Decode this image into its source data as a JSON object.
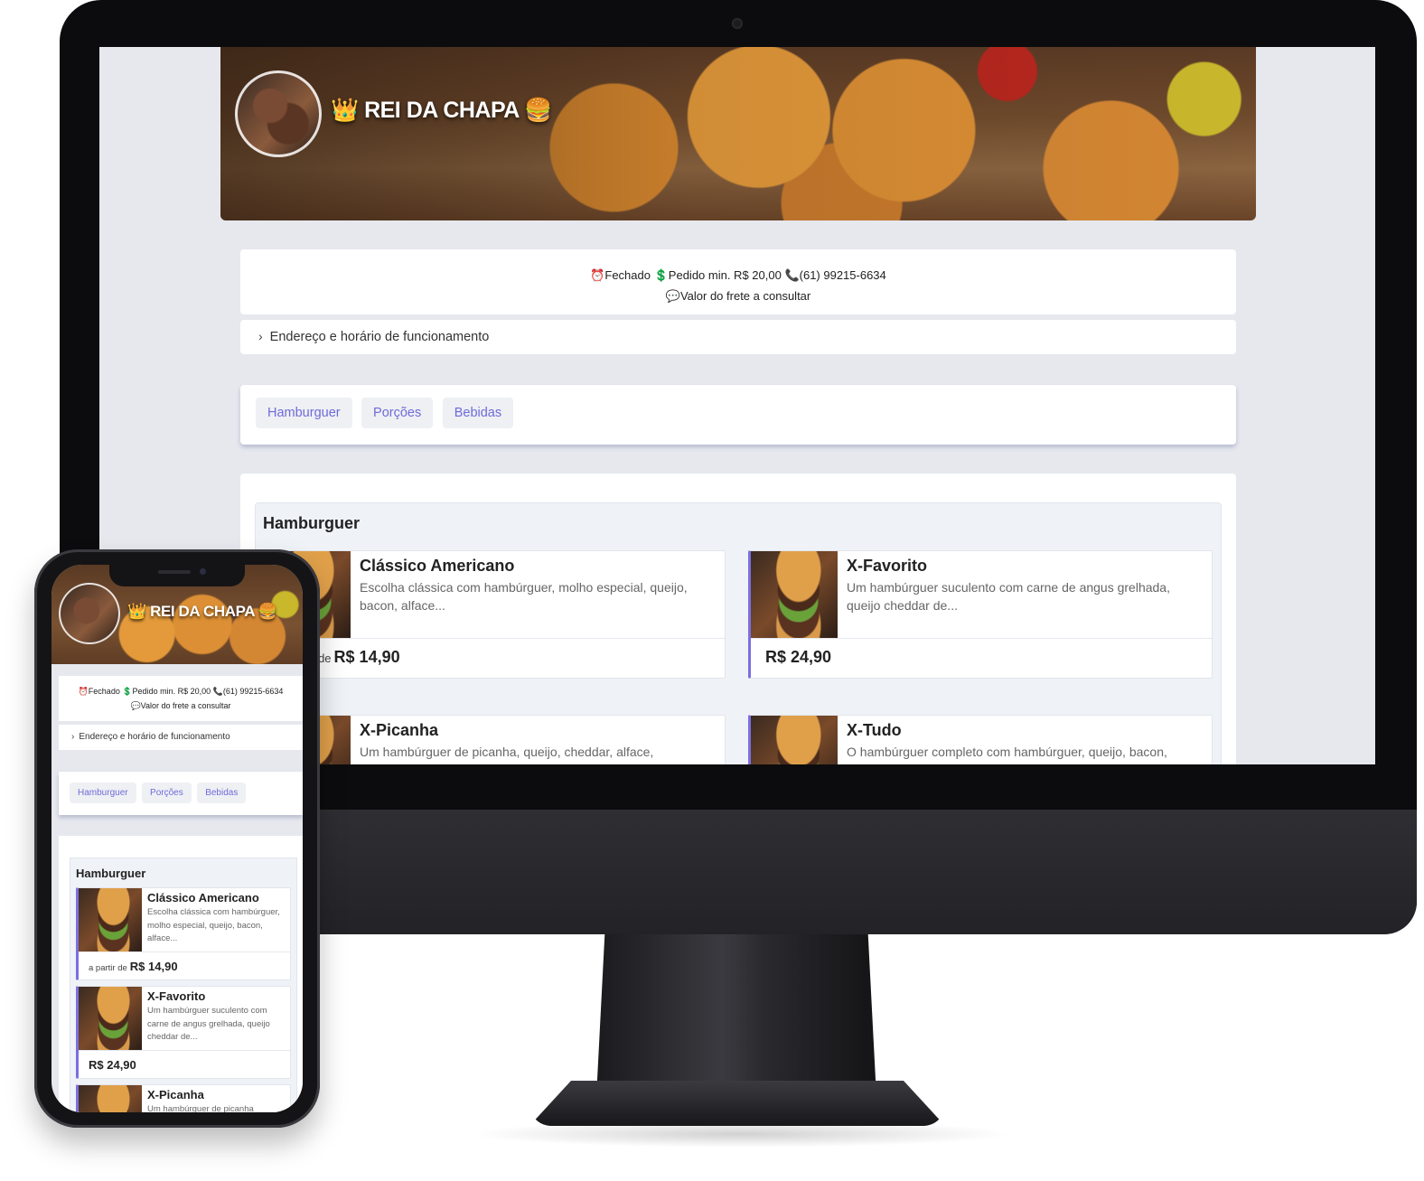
{
  "restaurant": {
    "title": "👑 REI DA CHAPA 🍔"
  },
  "info": {
    "status": "⏰Fechado",
    "min_order": "💲Pedido min. R$ 20,00",
    "phone": "📞(61) 99215-6634",
    "delivery": "💬Valor do frete a consultar"
  },
  "address_toggle": {
    "label": "Endereço e horário de funcionamento"
  },
  "tabs": [
    "Hamburguer",
    "Porções",
    "Bebidas"
  ],
  "category": {
    "title": "Hamburguer"
  },
  "price_prefix": "a partir de",
  "items": [
    {
      "name": "Clássico Americano",
      "desc_desktop": "Escolha clássica com hambúrguer, molho especial, queijo, bacon, alface...",
      "desc_mobile": "Escolha clássica com hambúrguer, molho especial, queijo, bacon, alface...",
      "price": "R$ 14,90"
    },
    {
      "name": "X-Favorito",
      "desc_desktop": "Um hambúrguer suculento com carne de angus grelhada, queijo cheddar de...",
      "desc_mobile": "Um hambúrguer suculento com carne de angus grelhada, queijo cheddar de...",
      "price": "R$ 24,90"
    },
    {
      "name": "X-Picanha",
      "desc_desktop": "Um hambúrguer de picanha, queijo, cheddar, alface,",
      "desc_mobile": "Um hambúrguer de picanha"
    },
    {
      "name": "X-Tudo",
      "desc_desktop": "O hambúrguer completo com hambúrguer, queijo, bacon,"
    }
  ]
}
